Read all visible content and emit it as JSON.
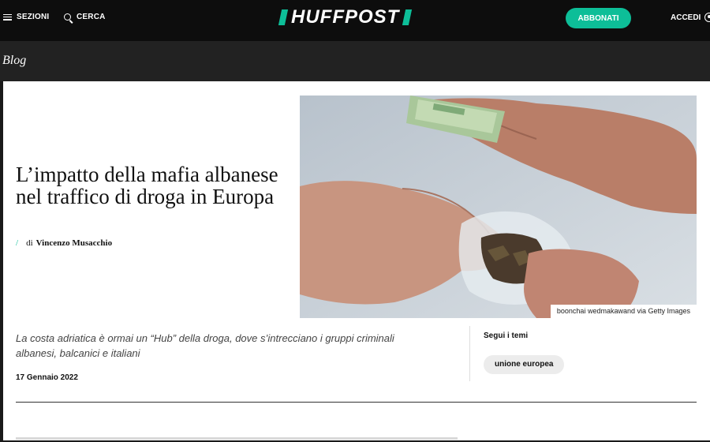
{
  "header": {
    "menu_label": "SEZIONI",
    "search_label": "CERCA",
    "logo_text": "HUFFPOST",
    "subscribe_label": "ABBONATI",
    "login_label": "ACCEDI",
    "accent_color": "#0dbe98"
  },
  "section": {
    "title": "Blog"
  },
  "article": {
    "headline": "L’impatto della mafia albanese nel traffico di droga in Europa",
    "byline_prefix": "di",
    "author": "Vincenzo Musacchio",
    "image_credit": "boonchai wedmakawand via Getty Images",
    "lede": "La costa adriatica è ormai un “Hub” della droga, dove s’intrecciano i gruppi criminali albanesi, balcanici e italiani",
    "date": "17 Gennaio 2022"
  },
  "topics": {
    "title": "Segui i temi",
    "items": [
      "unione europea"
    ]
  }
}
